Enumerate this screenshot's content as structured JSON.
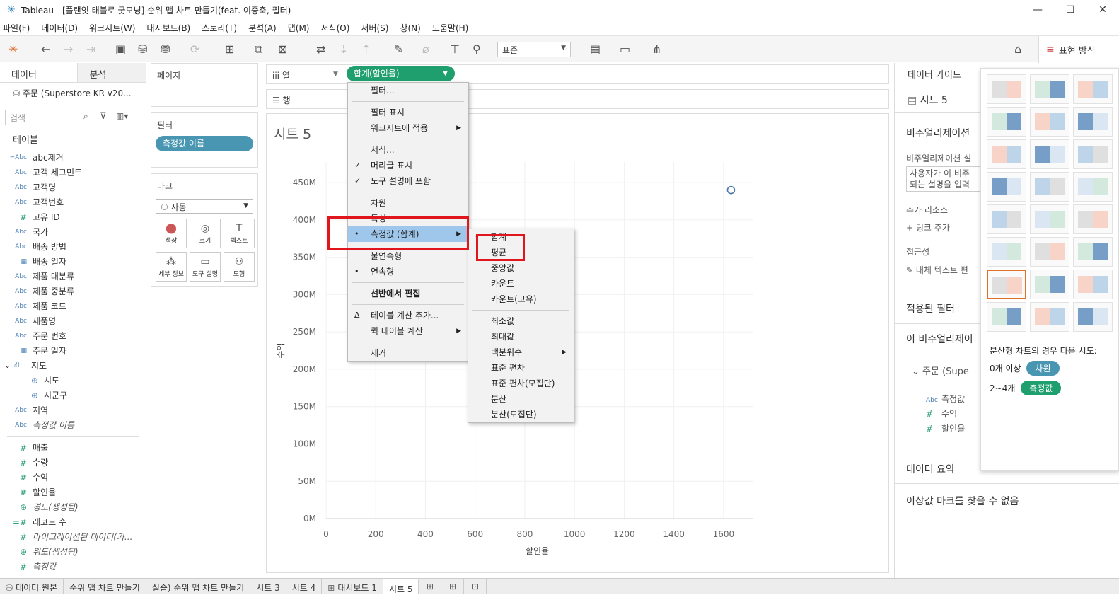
{
  "window": {
    "title": "Tableau - [플랜잇 태블로 굿모닝] 순위 맵 차트 만들기(feat. 이중축, 필터)",
    "minimize": "—",
    "maximize": "☐",
    "close": "✕"
  },
  "menubar": [
    "파일(F)",
    "데이터(D)",
    "워크시트(W)",
    "대시보드(B)",
    "스토리(T)",
    "분석(A)",
    "맵(M)",
    "서식(O)",
    "서버(S)",
    "창(N)",
    "도움말(H)"
  ],
  "toolbar": {
    "fit_select": "표준",
    "showme_label": "표현 방식"
  },
  "left_panel": {
    "tab_data": "데이터",
    "tab_analysis": "분석",
    "datasource": "주문 (Superstore KR v20...",
    "search_placeholder": "검색",
    "tables_header": "테이블",
    "dims": [
      {
        "icon": "=Abc",
        "label": "abc제거"
      },
      {
        "icon": "Abc",
        "label": "고객 세그먼트"
      },
      {
        "icon": "Abc",
        "label": "고객명"
      },
      {
        "icon": "Abc",
        "label": "고객번호"
      },
      {
        "icon": "#",
        "label": "고유 ID"
      },
      {
        "icon": "Abc",
        "label": "국가"
      },
      {
        "icon": "Abc",
        "label": "배송 방법"
      },
      {
        "icon": "date",
        "label": "배송 일자"
      },
      {
        "icon": "Abc",
        "label": "제품 대분류"
      },
      {
        "icon": "Abc",
        "label": "제품 중분류"
      },
      {
        "icon": "Abc",
        "label": "제품 코드"
      },
      {
        "icon": "Abc",
        "label": "제품명"
      },
      {
        "icon": "Abc",
        "label": "주문 번호"
      },
      {
        "icon": "date",
        "label": "주문 일자"
      }
    ],
    "hierarchy": {
      "label": "지도",
      "children": [
        "시도",
        "시군구"
      ]
    },
    "dims2": [
      {
        "icon": "Abc",
        "label": "지역"
      },
      {
        "icon": "Abc",
        "label": "측정값 이름"
      }
    ],
    "measures": [
      {
        "icon": "#",
        "label": "매출"
      },
      {
        "icon": "#",
        "label": "수량"
      },
      {
        "icon": "#",
        "label": "수익"
      },
      {
        "icon": "#",
        "label": "할인율"
      },
      {
        "icon": "globe",
        "label": "경도(생성됨)"
      },
      {
        "icon": "=#",
        "label": "레코드 수"
      },
      {
        "icon": "#",
        "label": "마이그레이션된 데이터(카..."
      },
      {
        "icon": "globe",
        "label": "위도(생성됨)"
      },
      {
        "icon": "#",
        "label": "측정값"
      }
    ]
  },
  "panels": {
    "pages": "페이지",
    "filters": "필터",
    "filter_pill": "측정값 이름",
    "marks": "마크",
    "marks_type": "자동",
    "mark_buttons": [
      "색상",
      "크기",
      "텍스트",
      "세부 정보",
      "도구 설명",
      "도형"
    ]
  },
  "shelves": {
    "columns": "열",
    "rows": "행",
    "columns_pill": "합계(할인율)"
  },
  "sheet_title": "시트 5",
  "chart_data": {
    "type": "scatter",
    "x": [
      1630
    ],
    "y": [
      440
    ],
    "xlabel": "할인율",
    "ylabel": "수익",
    "x_ticks": [
      "0",
      "200",
      "400",
      "600",
      "800",
      "1000",
      "1200",
      "1400",
      "1600"
    ],
    "x_tick_vals": [
      0,
      200,
      400,
      600,
      800,
      1000,
      1200,
      1400,
      1600
    ],
    "y_ticks": [
      "0M",
      "50M",
      "100M",
      "150M",
      "200M",
      "250M",
      "300M",
      "350M",
      "400M",
      "450M"
    ],
    "y_tick_vals": [
      0,
      50,
      100,
      150,
      200,
      250,
      300,
      350,
      400,
      450
    ],
    "xlim": [
      0,
      1720
    ],
    "ylim": [
      0,
      470
    ]
  },
  "context_menu": {
    "items": [
      {
        "label": "필터...",
        "check": ""
      },
      {
        "sep": true
      },
      {
        "label": "필터 표시",
        "check": ""
      },
      {
        "label": "워크시트에 적용",
        "check": "",
        "sub": true
      },
      {
        "sep": true
      },
      {
        "label": "서식...",
        "check": ""
      },
      {
        "label": "머리글 표시",
        "check": "✓"
      },
      {
        "label": "도구 설명에 포함",
        "check": "✓"
      },
      {
        "sep": true
      },
      {
        "label": "차원",
        "check": ""
      },
      {
        "label": "특성",
        "check": ""
      },
      {
        "label": "측정값 (합계)",
        "check": "•",
        "sub": true,
        "hl": true
      },
      {
        "sep": true
      },
      {
        "label": "불연속형",
        "check": ""
      },
      {
        "label": "연속형",
        "check": "•"
      },
      {
        "sep": true
      },
      {
        "label": "선반에서 편집",
        "check": "",
        "bold": true
      },
      {
        "sep": true
      },
      {
        "label": "테이블 계산 추가...",
        "check": "Δ"
      },
      {
        "label": "퀵 테이블 계산",
        "check": "",
        "sub": true
      },
      {
        "sep": true
      },
      {
        "label": "제거",
        "check": ""
      }
    ]
  },
  "submenu": {
    "items": [
      {
        "label": "합계",
        "check": "•"
      },
      {
        "label": "평균",
        "check": ""
      },
      {
        "label": "중앙값",
        "check": ""
      },
      {
        "label": "카운트",
        "check": ""
      },
      {
        "label": "카운트(고유)",
        "check": ""
      },
      {
        "sep": true
      },
      {
        "label": "최소값",
        "check": ""
      },
      {
        "label": "최대값",
        "check": ""
      },
      {
        "label": "백분위수",
        "check": "",
        "sub": true
      },
      {
        "label": "표준 편차",
        "check": ""
      },
      {
        "label": "표준 편차(모집단)",
        "check": ""
      },
      {
        "label": "분산",
        "check": ""
      },
      {
        "label": "분산(모집단)",
        "check": ""
      }
    ]
  },
  "right_panel": {
    "guide_title": "데이터 가이드",
    "sheet": "시트 5",
    "viz_section": "비주얼리제이션",
    "viz_desc_label": "비주얼리제이션 설",
    "viz_desc_text1": "사용자가 이 비주",
    "viz_desc_text2": "되는 설명을 입력",
    "resources": "추가 리소스",
    "link_add": "링크 추가",
    "accessibility": "접근성",
    "alt_text": "대체 텍스트 편",
    "applied_filters": "적용된 필터",
    "this_viz": "이 비주얼리제이",
    "source": "주문 (Supe",
    "fields": [
      {
        "icon": "Abc",
        "label": "측정값 "
      },
      {
        "icon": "#",
        "label": "수익"
      },
      {
        "icon": "#",
        "label": "할인율"
      }
    ],
    "data_summary": "데이터 요약",
    "outliers": "이상값 마크를 찾을 수 없음"
  },
  "showme_hint": {
    "text": "분산형 차트의 경우 다음 시도:",
    "row1_prefix": "0개 이상",
    "row1_pill": "차원",
    "row2_prefix": "2~4개",
    "row2_pill": "측정값"
  },
  "bottom_tabs": [
    "데이터 원본",
    "순위 맵 차트 만들기",
    "실습) 순위 맵 차트 만들기",
    "시트 3",
    "시트 4",
    "대시보드 1",
    "시트 5"
  ],
  "colors": {
    "pill_green": "#1f9e6e",
    "pill_blue": "#4996b2",
    "highlight": "#9fc7ec",
    "red": "#e0161c"
  }
}
